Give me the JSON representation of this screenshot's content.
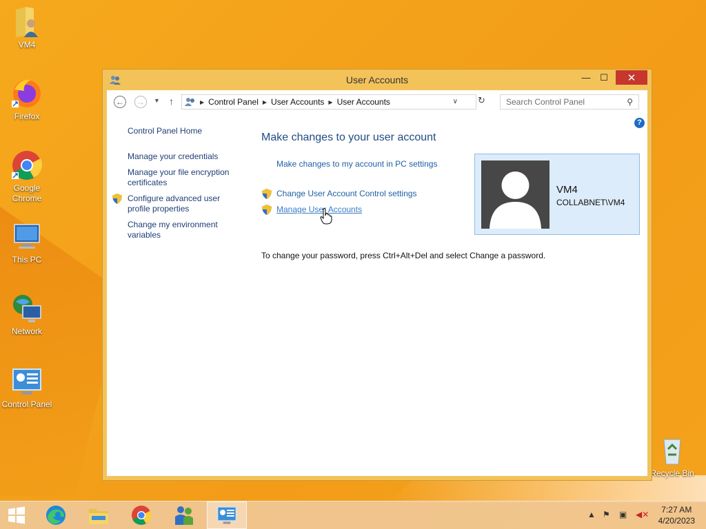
{
  "desktop": {
    "icons": [
      {
        "label": "VM4"
      },
      {
        "label": "Firefox"
      },
      {
        "label": "Google Chrome"
      },
      {
        "label": "This PC"
      },
      {
        "label": "Network"
      },
      {
        "label": "Control Panel"
      },
      {
        "label": "Recycle Bin"
      }
    ]
  },
  "window": {
    "title": "User Accounts",
    "controls": {
      "minimize": "—",
      "maximize": "☐",
      "close": "✕"
    },
    "address": {
      "segments": [
        "Control Panel",
        "User Accounts",
        "User Accounts"
      ]
    },
    "search": {
      "placeholder": "Search Control Panel"
    },
    "help": "?",
    "left_nav": {
      "home": "Control Panel Home",
      "items": [
        "Manage your credentials",
        "Manage your file encryption certificates",
        "Configure advanced user profile properties",
        "Change my environment variables"
      ]
    },
    "main": {
      "title": "Make changes to your user account",
      "pc_settings_link": "Make changes to my account in PC settings",
      "uac_link": "Change User Account Control settings",
      "manage_link": "Manage User Accounts",
      "password_note": "To change your password, press Ctrl+Alt+Del and select Change a password."
    },
    "user": {
      "name": "VM4",
      "domain": "COLLABNET\\VM4"
    }
  },
  "taskbar": {
    "clock": {
      "time": "7:27 AM",
      "date": "4/20/2023"
    }
  },
  "colors": {
    "desktop_bg": "#f6a91c",
    "window_frame": "#f3c35a",
    "link": "#1f5fa3",
    "close_button": "#c7372e"
  }
}
